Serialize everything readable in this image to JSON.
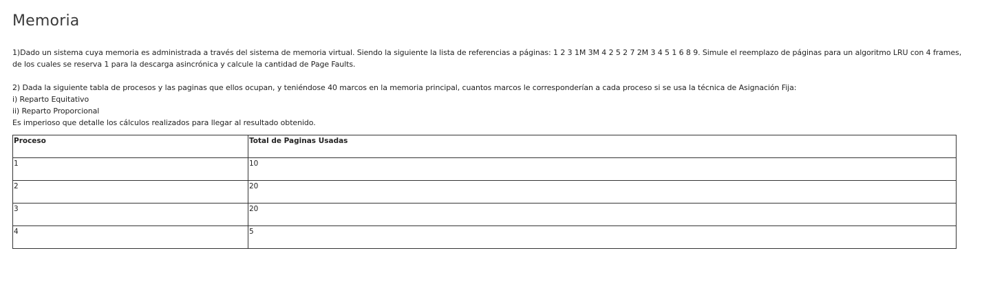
{
  "page": {
    "title": "Memoria"
  },
  "question1": {
    "text": "1)Dado un sistema cuya memoria es administrada a través del sistema de memoria virtual. Siendo la siguiente la lista de referencias a páginas: 1 2 3 1M 3M 4 2 5 2 7 2M 3 4 5 1 6 8 9. Simule el reemplazo de páginas para un algoritmo LRU con 4 frames, de los cuales se reserva 1 para la descarga asincrónica y calcule la cantidad de Page Faults."
  },
  "question2": {
    "intro": "2) Dada la siguiente tabla de procesos y las paginas que ellos ocupan, y teniéndose 40 marcos en la memoria principal, cuantos marcos le corresponderían a cada proceso si se usa la técnica de Asignación Fija:",
    "option_i": "i) Reparto Equitativo",
    "option_ii": "ii) Reparto Proporcional",
    "note": "Es imperioso que detalle los cálculos realizados para llegar al resultado obtenido."
  },
  "table": {
    "headers": [
      "Proceso",
      "Total de Paginas Usadas"
    ],
    "rows": [
      [
        "1",
        "10"
      ],
      [
        "2",
        "20"
      ],
      [
        "3",
        "20"
      ],
      [
        "4",
        "5"
      ]
    ]
  }
}
